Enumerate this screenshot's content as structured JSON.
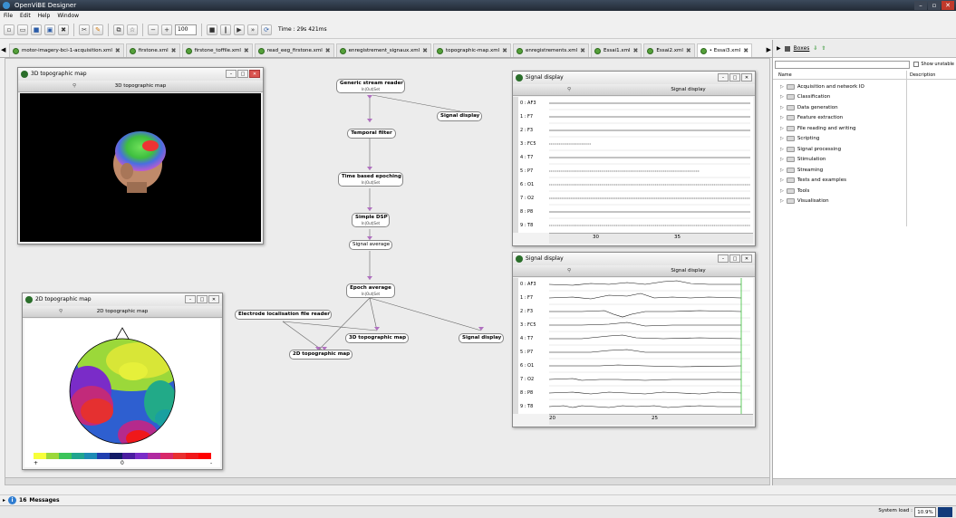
{
  "window": {
    "title": "OpenViBE Designer",
    "controls": [
      "–",
      "▫",
      "✕"
    ]
  },
  "menu": [
    "File",
    "Edit",
    "Help",
    "Window"
  ],
  "toolbar": {
    "zoom": "100",
    "time": "Time : 29s 421ms",
    "icons": [
      "new-icon",
      "open-icon",
      "save-icon",
      "save-as-icon",
      "close-icon",
      "cut-icon",
      "edit-icon",
      "copy-icon",
      "paste-icon",
      "zoom-out-icon",
      "zoom-in-icon",
      "play-icon",
      "pause-icon",
      "forward-icon",
      "stop-icon"
    ]
  },
  "tabs": [
    {
      "label": "motor-imagery-bci-1-acquisition.xml"
    },
    {
      "label": "firstone.xml"
    },
    {
      "label": "firstone_toffile.xml"
    },
    {
      "label": "read_eeg_firstone.xml"
    },
    {
      "label": "enregistrement_signaux.xml"
    },
    {
      "label": "topographic-map.xml"
    },
    {
      "label": "enregistrements.xml"
    },
    {
      "label": "Essai1.xml"
    },
    {
      "label": "Essai2.xml"
    },
    {
      "label": "• Essai3.xml",
      "active": true
    }
  ],
  "boxes": {
    "generic": {
      "title": "Generic stream reader",
      "sub": "In|Out|Set"
    },
    "sigdisp1": {
      "title": "Signal display"
    },
    "temporal": {
      "title": "Temporal filter"
    },
    "epoching": {
      "title": "Time based epoching",
      "sub": "In|Out|Set"
    },
    "dsp": {
      "title": "Simple DSP",
      "sub": "In|Out|Set"
    },
    "sigavg": {
      "title": "Signal average"
    },
    "epochavg": {
      "title": "Epoch average",
      "sub": "In|Out|Set"
    },
    "electrode": {
      "title": "Electrode localisation file reader"
    },
    "topo3d": {
      "title": "3D topographic map"
    },
    "topo2d": {
      "title": "2D topographic map"
    },
    "sigdisp2": {
      "title": "Signal display"
    }
  },
  "win3d": {
    "title": "3D topographic map",
    "toolbar": "3D topographic map"
  },
  "win2d": {
    "title": "2D topographic map",
    "toolbar": "2D topographic map",
    "scale": {
      "plus": "+",
      "zero": "0",
      "minus": "-"
    }
  },
  "sd1": {
    "title": "Signal display",
    "toolbar": "Signal display",
    "channels": [
      "0 : AF3",
      "1 : F7",
      "2 : F3",
      "3 : FC5",
      "4 : T7",
      "5 : P7",
      "6 : O1",
      "7 : O2",
      "8 : P8",
      "9 : T8"
    ],
    "xticks": [
      "30",
      "35"
    ]
  },
  "sd2": {
    "title": "Signal display",
    "toolbar": "Signal display",
    "channels": [
      "0 : AF3",
      "1 : F7",
      "2 : F3",
      "3 : FC5",
      "4 : T7",
      "5 : P7",
      "6 : O1",
      "7 : O2",
      "8 : P8",
      "9 : T8"
    ],
    "xticks": [
      "20",
      "25"
    ]
  },
  "side": {
    "tab": "Boxes",
    "show_unstable": "Show unstable",
    "col_name": "Name",
    "col_desc": "Description",
    "categories": [
      "Acquisition and network IO",
      "Classification",
      "Data generation",
      "Feature extraction",
      "File reading and writing",
      "Scripting",
      "Signal processing",
      "Stimulation",
      "Streaming",
      "Tests and examples",
      "Tools",
      "Visualisation"
    ]
  },
  "status": {
    "count": "16",
    "label": "Messages",
    "sysload_label": "System load :",
    "sysload_value": "10.9%"
  },
  "colors": {
    "accent": "#2f7dd1",
    "titlebar": "#2a3340",
    "wave": "#111111",
    "cursor": "#39c139"
  }
}
